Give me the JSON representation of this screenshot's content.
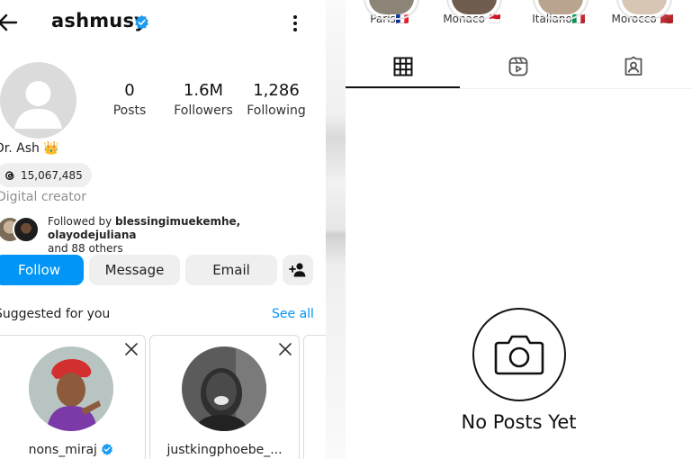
{
  "profile": {
    "username": "ashmusy",
    "display_name": "Dr. Ash 👑",
    "threads_count": "15,067,485",
    "category": "Digital creator",
    "followed_by_prefix": "Followed by ",
    "followed_by_names": "blessingimuekemhe, olayodejuliana",
    "followed_by_suffix": "and 88 others"
  },
  "stats": [
    {
      "value": "0",
      "label": "Posts"
    },
    {
      "value": "1.6M",
      "label": "Followers"
    },
    {
      "value": "1,286",
      "label": "Following"
    }
  ],
  "buttons": {
    "follow": "Follow",
    "message": "Message",
    "email": "Email"
  },
  "suggestions": {
    "title": "Suggested for you",
    "see_all": "See all",
    "cards": [
      {
        "username": "nons_miraj"
      },
      {
        "username": "justkingphoebe_..."
      }
    ]
  },
  "highlights": [
    {
      "label": "Paris🇫🇷"
    },
    {
      "label": "Monaco 🇲🇨"
    },
    {
      "label": "Italiano🇮🇹"
    },
    {
      "label": "Morocco 🇲🇦"
    }
  ],
  "empty_state": {
    "text": "No Posts Yet"
  },
  "colors": {
    "accent": "#0095f6",
    "button_grey": "#efefef",
    "verified": "#1d9bf0"
  },
  "icons": [
    "back-arrow-icon",
    "verified-icon",
    "more-options-icon",
    "threads-icon",
    "add-person-icon",
    "close-icon",
    "grid-icon",
    "reels-icon",
    "tagged-icon",
    "camera-icon"
  ]
}
